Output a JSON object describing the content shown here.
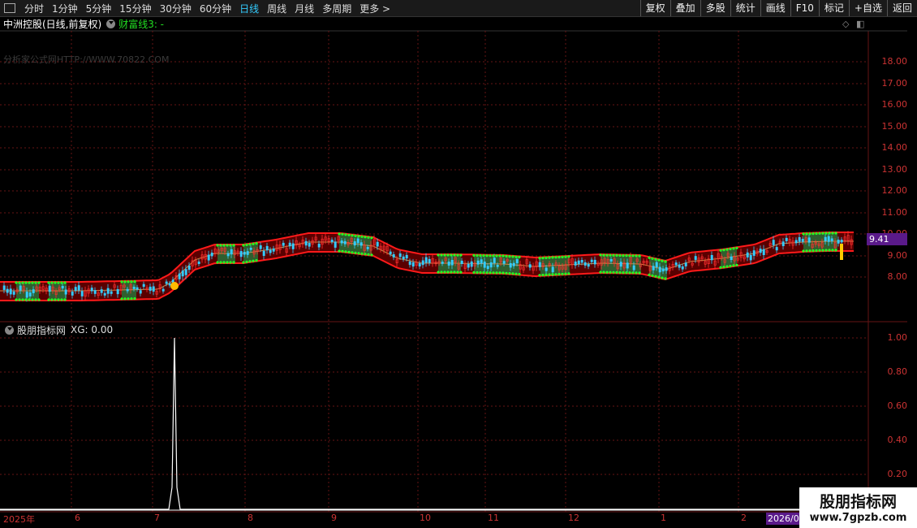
{
  "toolbar": {
    "periods": [
      "分时",
      "1分钟",
      "5分钟",
      "15分钟",
      "30分钟",
      "60分钟",
      "日线",
      "周线",
      "月线",
      "多周期",
      "更多 >"
    ],
    "active_period": "日线",
    "right_buttons": [
      "复权",
      "叠加",
      "多股",
      "统计",
      "画线",
      "F10",
      "标记",
      "+自选",
      "返回"
    ]
  },
  "main": {
    "stock_title": "中洲控股(日线,前复权)",
    "indicator_label": "财富线3: -",
    "watermark": "分析家公式网HTTP://WWW.70822.COM",
    "price_axis": [
      "18.00",
      "17.00",
      "16.00",
      "15.00",
      "14.00",
      "13.00",
      "12.00",
      "11.00",
      "10.00",
      "9.00",
      "8.00"
    ],
    "last_price": "9.41"
  },
  "sub": {
    "title": "股朋指标网",
    "xg_text": "XG: 0.00",
    "axis": [
      "1.00",
      "0.80",
      "0.60",
      "0.40",
      "0.20"
    ]
  },
  "xaxis": {
    "labels": [
      "2025年",
      "6",
      "7",
      "8",
      "9",
      "10",
      "11",
      "12",
      "1",
      "2"
    ],
    "year_badge": "2026/0"
  },
  "brand": {
    "name": "股朋指标网",
    "url": "www.7gpzb.com"
  },
  "colors": {
    "up": "#ff3030",
    "down": "#33ccff",
    "band": "#ff1a1a",
    "band_fill": "#5a0000",
    "green_zone": "#2f5f2f",
    "signal": "#22ff22",
    "grid": "#661515"
  }
}
